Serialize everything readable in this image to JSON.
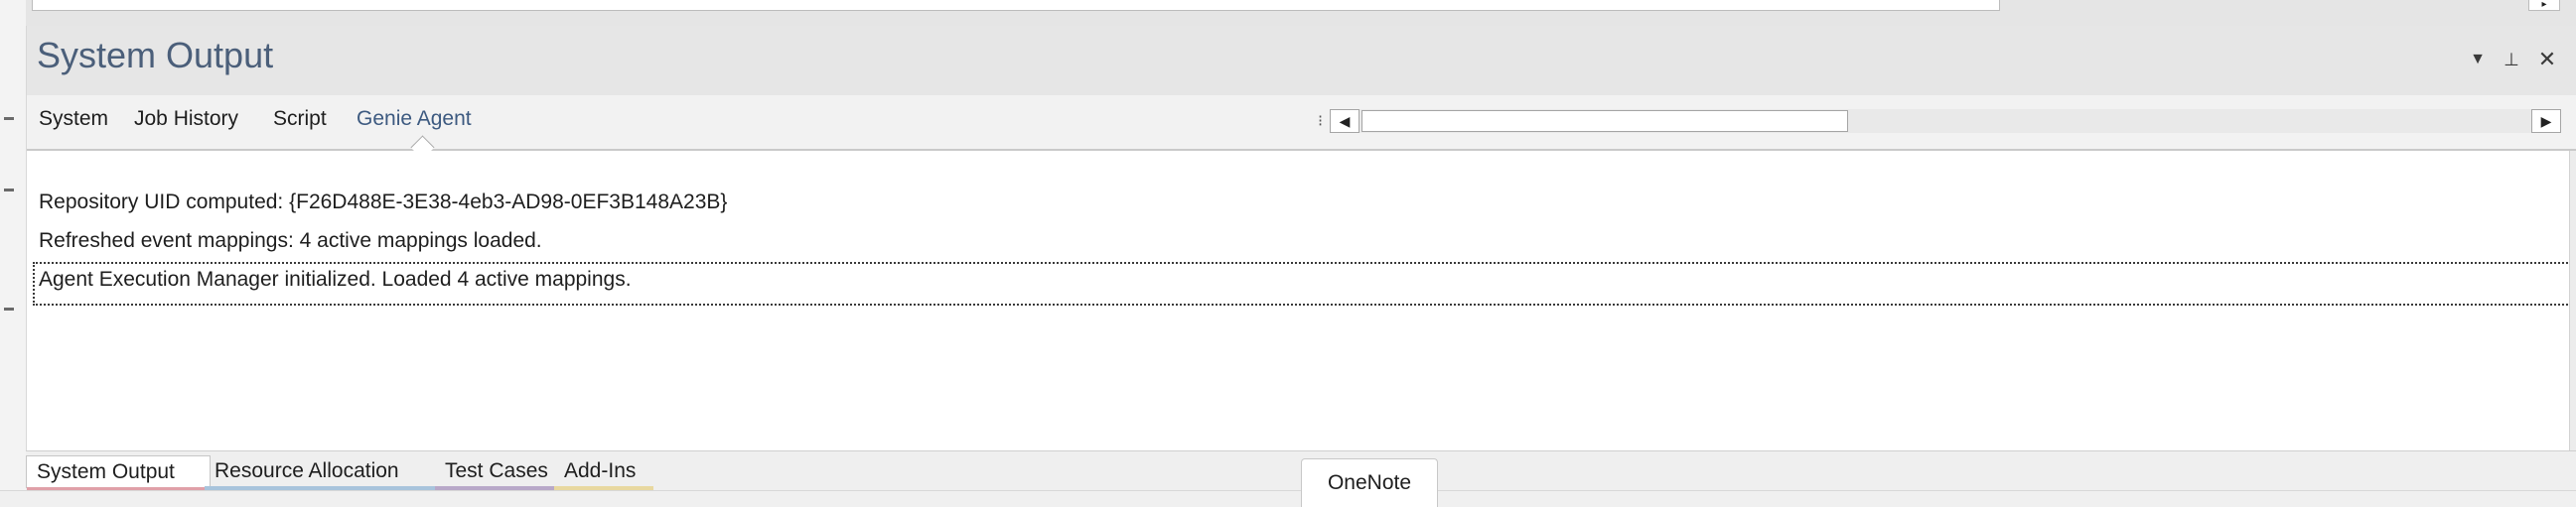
{
  "panel": {
    "title": "System Output",
    "header_buttons": {
      "dropdown_icon": "chevron-down-icon",
      "pin_icon": "pin-icon",
      "close_icon": "close-icon"
    },
    "tabs": [
      {
        "label": "System"
      },
      {
        "label": "Job History"
      },
      {
        "label": "Script"
      },
      {
        "label": "Genie Agent",
        "active": true
      }
    ],
    "output_lines": [
      "Repository UID computed: {F26D488E-3E38-4eb3-AD98-0EF3B148A23B}",
      "Refreshed event mappings: 4 active mappings loaded.",
      "Agent Execution Manager initialized. Loaded 4 active mappings."
    ]
  },
  "bottom_tabs": [
    {
      "label": "System Output",
      "color": "#e0a0a8",
      "active": true
    },
    {
      "label": "Resource Allocation",
      "color": "#a8c4dc"
    },
    {
      "label": "Test Cases",
      "color": "#b8a8c8"
    },
    {
      "label": "Add-Ins",
      "color": "#e8d8a0"
    }
  ],
  "tooltip": {
    "label": "OneNote"
  },
  "colors": {
    "title": "#4b5f7a",
    "active_tab": "#3d5a80"
  }
}
